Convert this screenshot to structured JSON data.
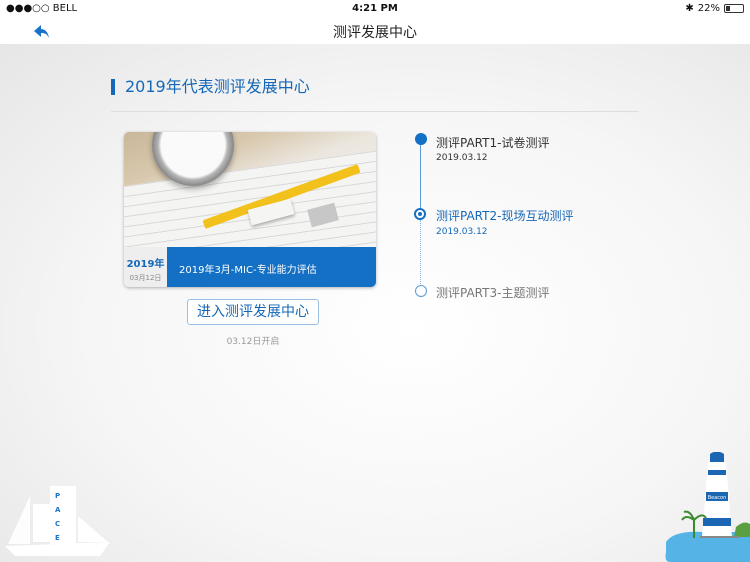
{
  "status_bar": {
    "carrier": "●●●○○ BELL",
    "wifi": "wifi-icon",
    "time": "4:21 PM",
    "bluetooth": "✱",
    "battery": "22%"
  },
  "nav": {
    "title": "测评发展中心",
    "back_icon": "reply-arrow-icon"
  },
  "section": {
    "title": "2019年代表测评发展中心"
  },
  "card": {
    "year": "2019年",
    "date": "03月12日",
    "name": "2019年3月-MIC-专业能力评估"
  },
  "enter_button": "进入测评发展中心",
  "open_note": "03.12日开启",
  "timeline": [
    {
      "title": "测评PART1-试卷测评",
      "date": "2019.03.12",
      "state": "done",
      "color": "#333333"
    },
    {
      "title": "测评PART2-现场互动测评",
      "date": "2019.03.12",
      "state": "current",
      "color": "#1568b8"
    },
    {
      "title": "测评PART3-主题测评",
      "date": "",
      "state": "pending",
      "color": "#777777"
    }
  ],
  "decor": {
    "ship_letters": [
      "P",
      "A",
      "C",
      "E"
    ],
    "lighthouse_sign": "Beacon"
  },
  "colors": {
    "accent": "#1470c4"
  }
}
